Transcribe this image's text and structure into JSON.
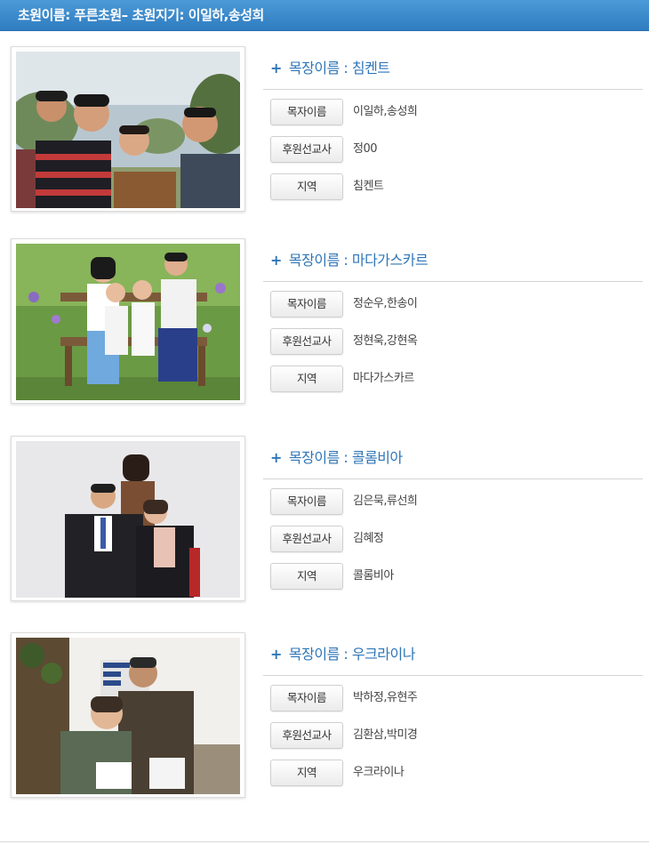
{
  "header": {
    "title": "초원이름: 푸른초원– 초원지기: 이일하,송성희"
  },
  "labels": {
    "pastor": "목자이름",
    "missionary": "후원선교사",
    "region": "지역"
  },
  "cells": [
    {
      "title_prefix": "목장이름",
      "title_name": "침켄트",
      "pastor": "이일하,송성희",
      "missionary": "정00",
      "region": "침켄트",
      "photo_icon": "family-photo"
    },
    {
      "title_prefix": "목장이름",
      "title_name": "마다가스카르",
      "pastor": "정순우,한송이",
      "missionary": "정현욱,강현옥",
      "region": "마다가스카르",
      "photo_icon": "family-photo"
    },
    {
      "title_prefix": "목장이름",
      "title_name": "콜롬비아",
      "pastor": "김은묵,류선희",
      "missionary": "김혜정",
      "region": "콜롬비아",
      "photo_icon": "family-photo"
    },
    {
      "title_prefix": "목장이름",
      "title_name": "우크라이나",
      "pastor": "박하정,유현주",
      "missionary": "김환삼,박미경",
      "region": "우크라이나",
      "photo_icon": "couple-photo"
    }
  ],
  "colors": {
    "header": "#3a89cc",
    "title": "#2f76b7"
  }
}
